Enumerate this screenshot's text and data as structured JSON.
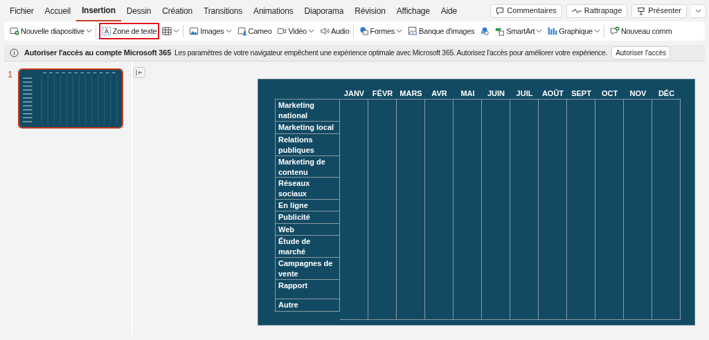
{
  "tabs": [
    {
      "label": "Fichier",
      "selected": false
    },
    {
      "label": "Accueil",
      "selected": false
    },
    {
      "label": "Insertion",
      "selected": true
    },
    {
      "label": "Dessin",
      "selected": false
    },
    {
      "label": "Création",
      "selected": false
    },
    {
      "label": "Transitions",
      "selected": false
    },
    {
      "label": "Animations",
      "selected": false
    },
    {
      "label": "Diaporama",
      "selected": false
    },
    {
      "label": "Révision",
      "selected": false
    },
    {
      "label": "Affichage",
      "selected": false
    },
    {
      "label": "Aide",
      "selected": false
    }
  ],
  "header_buttons": [
    "Commentaires",
    "Rattrapage",
    "Présenter"
  ],
  "toolbar": [
    {
      "label": "Nouvelle diapositive",
      "dropdown": true,
      "highlighted": false,
      "separator_after": true
    },
    {
      "label": "Zone de texte",
      "dropdown": false,
      "highlighted": true,
      "separator_after": false
    },
    {
      "dropdown": true,
      "highlighted": false,
      "separator_after": true
    },
    {
      "label": "Images",
      "dropdown": true,
      "highlighted": false,
      "separator_after": false
    },
    {
      "label": "Cameo",
      "dropdown": false,
      "highlighted": false,
      "separator_after": false
    },
    {
      "label": "Vidéo",
      "dropdown": true,
      "highlighted": false,
      "separator_after": false
    },
    {
      "label": "Audio",
      "dropdown": false,
      "highlighted": false,
      "separator_after": true
    },
    {
      "label": "Formes",
      "dropdown": true,
      "highlighted": false,
      "separator_after": false
    },
    {
      "label": "Banque d'images",
      "dropdown": false,
      "highlighted": false,
      "separator_after": false
    },
    {
      "dropdown": false,
      "highlighted": false,
      "separator_after": false
    },
    {
      "label": "SmartArt",
      "dropdown": true,
      "highlighted": false,
      "separator_after": false
    },
    {
      "label": "Graphique",
      "dropdown": true,
      "highlighted": false,
      "separator_after": true
    },
    {
      "label": "Nouveau comm",
      "dropdown": false,
      "highlighted": false,
      "separator_after": false
    }
  ],
  "info_bar": {
    "title": "Autoriser l'accès au compte Microsoft 365",
    "message": "Les paramètres de votre navigateur empêchent une expérience optimale avec Microsoft 365. Autorisez l'accès pour améliorer votre expérience.",
    "button": "Autoriser l'accès"
  },
  "slide_panel": {
    "slides": [
      {
        "number": "1",
        "selected": true
      }
    ]
  },
  "slide": {
    "columns": [
      "JANV",
      "FÉVR",
      "MARS",
      "AVR",
      "MAI",
      "JUIN",
      "JUIL",
      "AOÛT",
      "SEPT",
      "OCT",
      "NOV",
      "DÉC"
    ],
    "rows": [
      "Marketing national",
      "Marketing local",
      "Relations publiques",
      "Marketing de contenu",
      "Réseaux sociaux",
      "En ligne",
      "Publicité",
      "Web",
      "Étude de marché",
      "Campagnes de vente",
      "Rapport",
      "Autre"
    ]
  }
}
